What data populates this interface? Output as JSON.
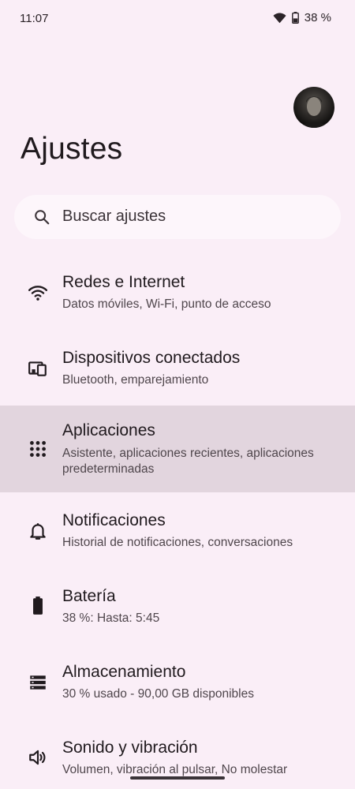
{
  "status": {
    "time": "11:07",
    "battery": "38 %"
  },
  "title": "Ajustes",
  "search": {
    "label": "Buscar ajustes"
  },
  "items": [
    {
      "title": "Redes e Internet",
      "subtitle": "Datos móviles, Wi-Fi, punto de acceso",
      "icon": "wifi-icon"
    },
    {
      "title": "Dispositivos conectados",
      "subtitle": "Bluetooth, emparejamiento",
      "icon": "devices-icon"
    },
    {
      "title": "Aplicaciones",
      "subtitle": "Asistente, aplicaciones recientes, aplicaciones predeterminadas",
      "icon": "apps-grid-icon"
    },
    {
      "title": "Notificaciones",
      "subtitle": "Historial de notificaciones, conversaciones",
      "icon": "bell-icon"
    },
    {
      "title": "Batería",
      "subtitle": "38 %: Hasta: 5:45",
      "icon": "battery-icon"
    },
    {
      "title": "Almacenamiento",
      "subtitle": "30 % usado - 90,00 GB disponibles",
      "icon": "storage-icon"
    },
    {
      "title": "Sonido y vibración",
      "subtitle": "Volumen, vibración al pulsar, No molestar",
      "icon": "volume-icon"
    }
  ],
  "colors": {
    "background": "#faeef7",
    "highlight": "#e2d5de",
    "search_bg": "#fdf6fb"
  }
}
